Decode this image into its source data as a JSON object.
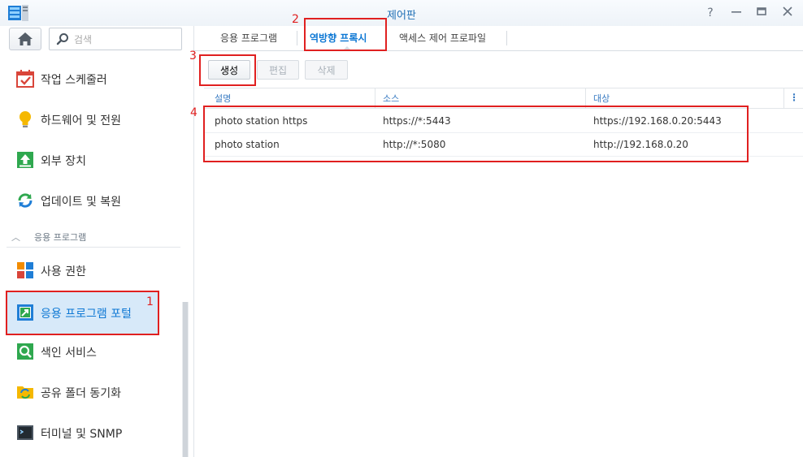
{
  "window": {
    "title": "제어판",
    "buttons": [
      "help",
      "minimize",
      "maximize",
      "close"
    ]
  },
  "sidebar": {
    "search_placeholder": "검색",
    "items_top": [
      {
        "label": "작업 스케줄러",
        "icon": "calendar-check-icon"
      },
      {
        "label": "하드웨어 및 전원",
        "icon": "lightbulb-icon"
      },
      {
        "label": "외부 장치",
        "icon": "upload-arrow-icon"
      },
      {
        "label": "업데이트 및 복원",
        "icon": "refresh-icon"
      }
    ],
    "section_title": "응용 프로그램",
    "items_bottom": [
      {
        "label": "사용 권한",
        "icon": "grid-permission-icon"
      },
      {
        "label": "응용 프로그램 포털",
        "icon": "portal-arrow-icon",
        "active": true
      },
      {
        "label": "색인 서비스",
        "icon": "search-index-icon"
      },
      {
        "label": "공유 폴더 동기화",
        "icon": "folder-sync-icon"
      },
      {
        "label": "터미널 및 SNMP",
        "icon": "terminal-icon"
      }
    ]
  },
  "tabs": [
    {
      "label": "응용 프로그램"
    },
    {
      "label": "역방향 프록시",
      "active": true
    },
    {
      "label": "액세스 제어 프로파일"
    }
  ],
  "toolbar": {
    "create_label": "생성",
    "edit_label": "편집",
    "delete_label": "삭제"
  },
  "table": {
    "headers": [
      "설명",
      "소스",
      "대상"
    ],
    "rows": [
      [
        "photo station https",
        "https://*:5443",
        "https://192.168.0.20:5443"
      ],
      [
        "photo station",
        "http://*:5080",
        "http://192.168.0.20"
      ]
    ]
  },
  "annotations": [
    "1",
    "2",
    "3",
    "4"
  ],
  "colors": {
    "accent": "#0e78d4",
    "active_bg": "#d7e9f9",
    "annotation": "#e02020"
  }
}
